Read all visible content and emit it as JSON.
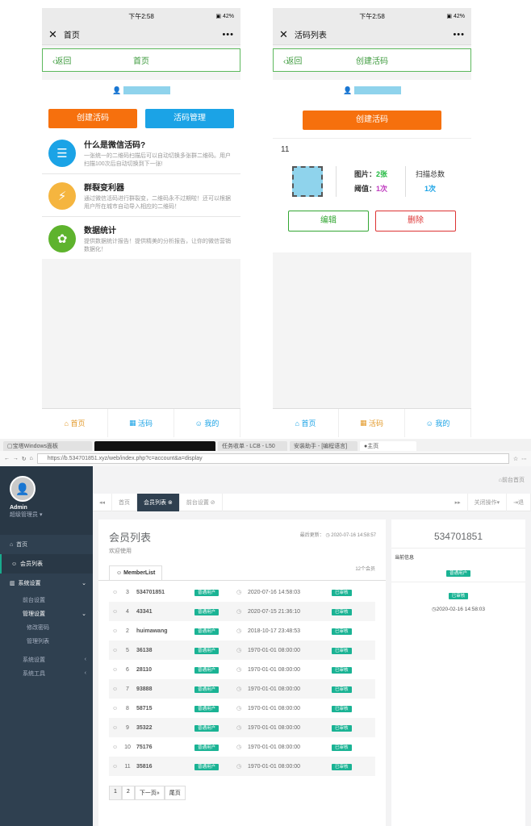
{
  "phone": {
    "status_time": "下午2:58",
    "status_right": "42",
    "left": {
      "title": "首页",
      "back": "返回",
      "nav_title": "首页",
      "btn_create": "创建活码",
      "btn_manage": "活码管理",
      "features": [
        {
          "title": "什么是微信活码?",
          "desc": "一张统一的二维码扫描后可以自动切换多张群二维码。用户扫描100次后自动切换到下一张!",
          "color": "#1ba3e6",
          "icon": "clipboard-icon"
        },
        {
          "title": "群裂变利器",
          "desc": "通过微信活码进行群裂变，二维码永不过期啦！还可以根据用户所在城市自动导入相应的二维码！",
          "color": "#f5b53f",
          "icon": "bolt-icon"
        },
        {
          "title": "数据统计",
          "desc": "提供数据统计报告！提供精美的分析报告，让你的微信营销数据化！",
          "color": "#5eb32d",
          "icon": "gear-icon"
        }
      ],
      "footer": [
        "首页",
        "活码",
        "我的"
      ]
    },
    "right": {
      "title": "活码列表",
      "back": "返回",
      "nav_title": "创建活码",
      "btn_create": "创建活码",
      "item_title": "11",
      "pic_label": "图片：",
      "pic_value": "2张",
      "threshold_label": "阈值：",
      "threshold_value": "1次",
      "scan_label": "扫描总数",
      "scan_value": "1次",
      "edit": "编辑",
      "delete": "删除",
      "footer": [
        "首页",
        "活码",
        "我的"
      ]
    }
  },
  "browser": {
    "tabs": [
      "宝塔Windows面板",
      "",
      "任务收单 - LCB - L50",
      "安装助手 - [编程语言]",
      "主页"
    ],
    "url": "https://b.534701851.xyz/web/index.php?c=account&a=display"
  },
  "admin": {
    "user": "Admin",
    "role": "超级管理员",
    "menu": [
      "首页",
      "会员列表",
      "系统设置",
      "前台设置",
      "管理设置",
      "修改密码",
      "管理列表",
      "系统设置",
      "系统工具"
    ],
    "crumb": "前台首页",
    "tabs": [
      "首页",
      "会员列表",
      "前台设置"
    ],
    "tab_right": [
      "关闭操作",
      "退"
    ],
    "page_title": "会员列表",
    "page_sub": "欢迎使用",
    "updated": "最后更新：",
    "updated_time": "2020-07-16 14:58:57",
    "list_tab": "MemberList",
    "count": "12个会员",
    "members": [
      {
        "id": "3",
        "name": "534701851",
        "badge": "普通用户",
        "time": "2020-07-16 14:58:03",
        "status": "已审核"
      },
      {
        "id": "4",
        "name": "43341",
        "badge": "普通用户",
        "time": "2020-07-15 21:36:10",
        "status": "已审核"
      },
      {
        "id": "2",
        "name": "huimawang",
        "badge": "普通用户",
        "time": "2018-10-17 23:48:53",
        "status": "已审核"
      },
      {
        "id": "5",
        "name": "36138",
        "badge": "普通用户",
        "time": "1970-01-01 08:00:00",
        "status": "已审核"
      },
      {
        "id": "6",
        "name": "28110",
        "badge": "普通用户",
        "time": "1970-01-01 08:00:00",
        "status": "已审核"
      },
      {
        "id": "7",
        "name": "93888",
        "badge": "普通用户",
        "time": "1970-01-01 08:00:00",
        "status": "已审核"
      },
      {
        "id": "8",
        "name": "58715",
        "badge": "普通用户",
        "time": "1970-01-01 08:00:00",
        "status": "已审核"
      },
      {
        "id": "9",
        "name": "35322",
        "badge": "普通用户",
        "time": "1970-01-01 08:00:00",
        "status": "已审核"
      },
      {
        "id": "10",
        "name": "75176",
        "badge": "普通用户",
        "time": "1970-01-01 08:00:00",
        "status": "已审核"
      },
      {
        "id": "11",
        "name": "35816",
        "badge": "普通用户",
        "time": "1970-01-01 08:00:00",
        "status": "已审核"
      }
    ],
    "pager": [
      "1",
      "2",
      "下一页»",
      "尾页"
    ],
    "detail": {
      "name": "534701851",
      "label": "当前信息",
      "badge1": "普通用户",
      "badge2": "已审核",
      "time": "2020-02-16 14:58:03"
    }
  }
}
